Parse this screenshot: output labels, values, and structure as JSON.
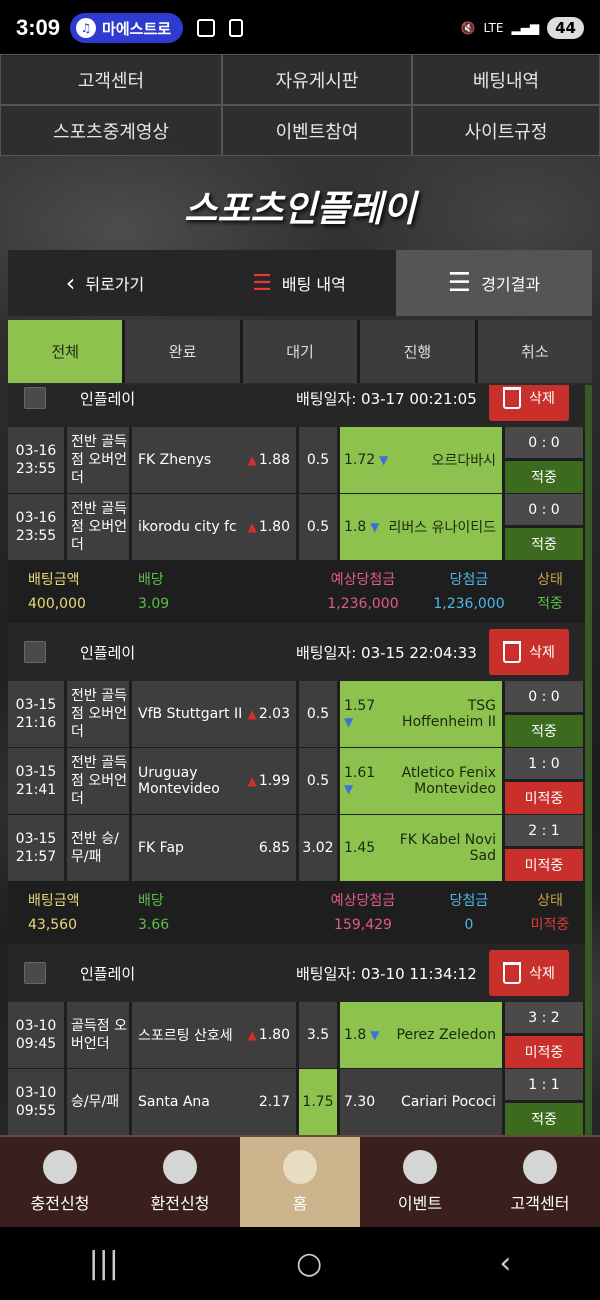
{
  "status": {
    "time": "3:09",
    "pill": "마에스트로",
    "battery": "44",
    "net": "LTE"
  },
  "topnav": [
    "고객센터",
    "자유게시판",
    "베팅내역",
    "스포츠중계영상",
    "이벤트참여",
    "사이트규정"
  ],
  "title": "스포츠인플레이",
  "bar": {
    "back": "뒤로가기",
    "history": "배팅 내역",
    "results": "경기결과"
  },
  "tabs": [
    "전체",
    "완료",
    "대기",
    "진행",
    "취소"
  ],
  "labels": {
    "amount": "배팅금액",
    "odds": "배당",
    "expected": "예상당첨금",
    "won": "당첨금",
    "state": "상태",
    "delete": "삭제"
  },
  "cards": [
    {
      "type": "인플레이",
      "date": "배팅일자: 03-17 00:21:05",
      "rows": [
        {
          "time": "03-16\n23:55",
          "market": "전반 골득점 오버언더",
          "home": "FK Zhenys",
          "home_odds": "1.88",
          "line": "0.5",
          "away_odds": "1.72",
          "away": "오르다바시",
          "score": "0 : 0",
          "state": "적중"
        },
        {
          "time": "03-16\n23:55",
          "market": "전반 골득점 오버언더",
          "home": "ikorodu city fc",
          "home_odds": "1.80",
          "line": "0.5",
          "away_odds": "1.8",
          "away": "리버스 유나이티드",
          "score": "0 : 0",
          "state": "적중"
        }
      ],
      "summary": {
        "amount": "400,000",
        "odds": "3.09",
        "expected": "1,236,000",
        "won": "1,236,000",
        "state": "적중"
      }
    },
    {
      "type": "인플레이",
      "date": "배팅일자: 03-15 22:04:33",
      "rows": [
        {
          "time": "03-15\n21:16",
          "market": "전반 골득점 오버언더",
          "home": "VfB Stuttgart II",
          "home_odds": "2.03",
          "line": "0.5",
          "away_odds": "1.57",
          "away": "TSG Hoffenheim II",
          "score": "0 : 0",
          "state": "적중"
        },
        {
          "time": "03-15\n21:41",
          "market": "전반 골득점 오버언더",
          "home": "Uruguay Montevideo",
          "home_odds": "1.99",
          "line": "0.5",
          "away_odds": "1.61",
          "away": "Atletico Fenix Montevideo",
          "score": "1 : 0",
          "state": "미적중"
        },
        {
          "time": "03-15\n21:57",
          "market": "전반 승/무/패",
          "home": "FK Fap",
          "home_odds": "6.85",
          "line": "3.02",
          "away_odds": "1.45",
          "away": "FK Kabel Novi Sad",
          "score": "2 : 1",
          "state": "미적중"
        }
      ],
      "summary": {
        "amount": "43,560",
        "odds": "3.66",
        "expected": "159,429",
        "won": "0",
        "state": "미적중"
      }
    },
    {
      "type": "인플레이",
      "date": "배팅일자: 03-10 11:34:12",
      "rows": [
        {
          "time": "03-10\n09:45",
          "market": "골득점 오버언더",
          "home": "스포르팅 산호세",
          "home_odds": "1.80",
          "line": "3.5",
          "away_odds": "1.8",
          "away": "Perez Zeledon",
          "score": "3 : 2",
          "state": "미적중"
        },
        {
          "time": "03-10\n09:55",
          "market": "승/무/패",
          "home": "Santa Ana",
          "home_odds": "2.17",
          "line": "1.75",
          "away_odds": "7.30",
          "away": "Cariari Pococi",
          "score": "1 : 1",
          "state": "적중"
        }
      ]
    }
  ],
  "bottomnav": [
    "충전신청",
    "환전신청",
    "홈",
    "이벤트",
    "고객센터"
  ]
}
